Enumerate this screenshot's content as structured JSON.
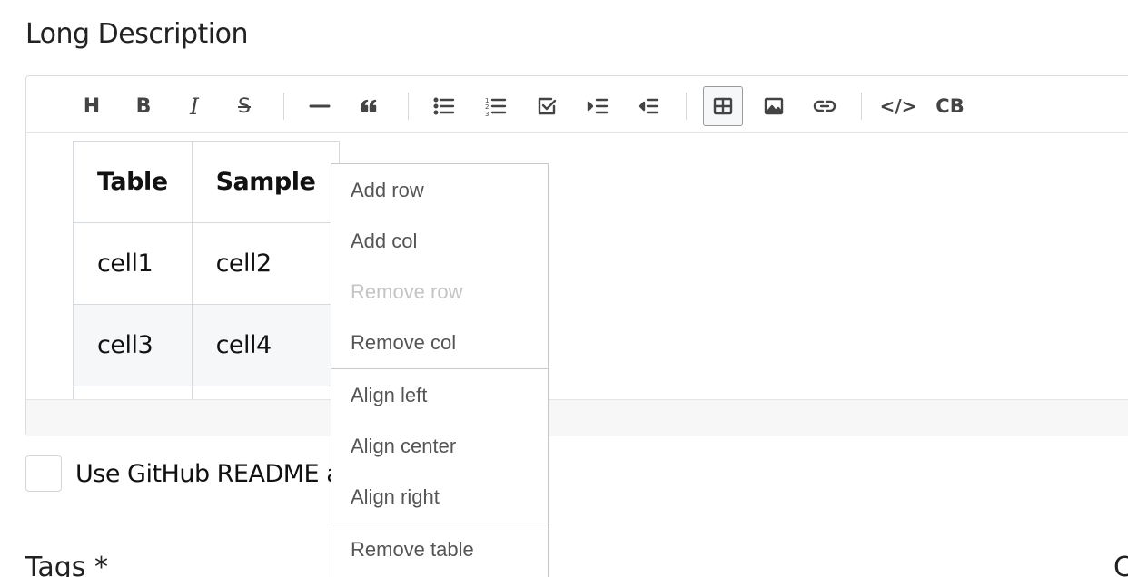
{
  "section": {
    "label": "Long Description"
  },
  "toolbar": {
    "buttons": [
      {
        "name": "heading-button",
        "icon": "heading-icon",
        "text": "H"
      },
      {
        "name": "bold-button",
        "icon": "bold-icon",
        "text": "B"
      },
      {
        "name": "italic-button",
        "icon": "italic-icon",
        "text": "I"
      },
      {
        "name": "strike-button",
        "icon": "strikethrough-icon",
        "text": "S"
      },
      {
        "name": "hr-button",
        "icon": "horizontal-rule-icon"
      },
      {
        "name": "quote-button",
        "icon": "quote-icon"
      },
      {
        "name": "bullet-list-button",
        "icon": "bullet-list-icon"
      },
      {
        "name": "ordered-list-button",
        "icon": "ordered-list-icon"
      },
      {
        "name": "task-list-button",
        "icon": "task-list-icon"
      },
      {
        "name": "indent-button",
        "icon": "indent-icon"
      },
      {
        "name": "outdent-button",
        "icon": "outdent-icon"
      },
      {
        "name": "table-button",
        "icon": "table-icon",
        "active": true
      },
      {
        "name": "image-button",
        "icon": "image-icon"
      },
      {
        "name": "link-button",
        "icon": "link-icon"
      },
      {
        "name": "code-button",
        "icon": "code-icon",
        "text": "</>"
      },
      {
        "name": "codeblock-button",
        "icon": "codeblock-icon",
        "text": "CB"
      }
    ]
  },
  "table": {
    "headers": [
      "Table",
      "Sample"
    ],
    "rows": [
      [
        "cell1",
        "cell2"
      ],
      [
        "cell3",
        "cell4"
      ]
    ]
  },
  "context_menu": {
    "groups": [
      {
        "items": [
          {
            "label": "Add row",
            "enabled": true
          },
          {
            "label": "Add col",
            "enabled": true
          },
          {
            "label": "Remove row",
            "enabled": false
          },
          {
            "label": "Remove col",
            "enabled": true
          }
        ]
      },
      {
        "items": [
          {
            "label": "Align left",
            "enabled": true
          },
          {
            "label": "Align center",
            "enabled": true
          },
          {
            "label": "Align right",
            "enabled": true
          }
        ]
      },
      {
        "items": [
          {
            "label": "Remove table",
            "enabled": true
          }
        ]
      }
    ]
  },
  "github_readme": {
    "label": "Use GitHub README a",
    "checked": false
  },
  "tags": {
    "label": "Tags *"
  },
  "right_edge": {
    "text": "C"
  }
}
